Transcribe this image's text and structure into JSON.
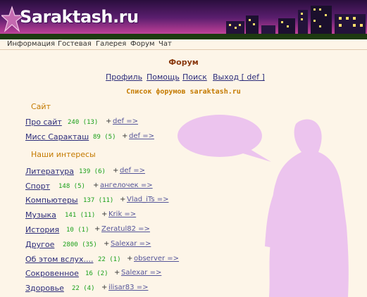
{
  "site": {
    "logo": "Saraktash.ru"
  },
  "topnav": [
    "Информация",
    "Гостевая",
    "Галерея",
    "Форум",
    "Чат"
  ],
  "page_title": "Форум",
  "usernav": [
    "Профиль",
    "Помощь",
    "Поиск",
    "Выход [ def ]"
  ],
  "list_title": "Список форумов saraktash.ru",
  "categories": [
    {
      "name": "Сайт",
      "forums": [
        {
          "name": "Про сайт",
          "count": "240 (13)",
          "plus": "+",
          "last": "def =>"
        },
        {
          "name": "Мисс Саракташ",
          "count": "89 (5)",
          "plus": "+",
          "last": "def =>"
        }
      ]
    },
    {
      "name": "Наши интересы",
      "forums": [
        {
          "name": "Литература",
          "count": "139 (6)",
          "plus": "+",
          "last": "def =>"
        },
        {
          "name": "Спорт",
          "count": "148 (5)",
          "plus": "+",
          "last": "ангелочек =>"
        },
        {
          "name": "Компьютеры",
          "count": "137 (11)",
          "plus": "+",
          "last": "Vlad_iTs =>"
        },
        {
          "name": "Музыка",
          "count": "141 (11)",
          "plus": "+",
          "last": "Krik =>"
        },
        {
          "name": "История",
          "count": "10 (1)",
          "plus": "+",
          "last": "Zeratul82 =>"
        },
        {
          "name": "Другое",
          "count": "2800 (35)",
          "plus": "+",
          "last": "Salexar =>"
        },
        {
          "name": "Об этом вслух....",
          "count": "22 (1)",
          "plus": "+",
          "last": "observer =>"
        },
        {
          "name": "Сокровенное",
          "count": "16 (2)",
          "plus": "+",
          "last": "Salexar =>"
        },
        {
          "name": "Здоровье",
          "count": "22 (4)",
          "plus": "+",
          "last": "ilisar83 =>"
        }
      ]
    }
  ]
}
